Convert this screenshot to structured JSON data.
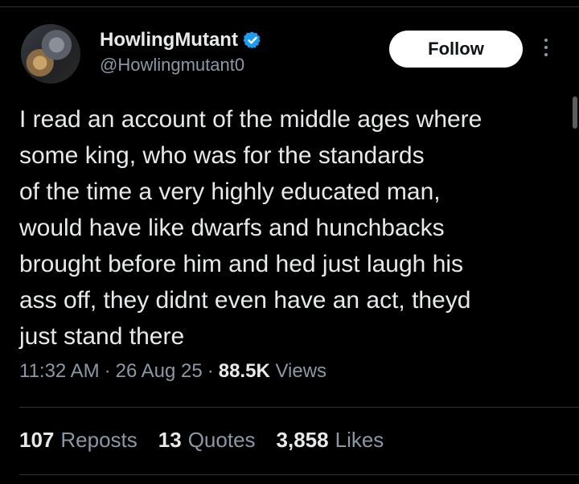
{
  "author": {
    "display_name": "HowlingMutant",
    "handle": "@Howlingmutant0",
    "verified": true
  },
  "actions": {
    "follow_label": "Follow"
  },
  "tweet": {
    "text": "I read an account of the middle ages where\nsome king, who was for the standards\nof the time a very highly educated man,\nwould have like dwarfs and hunchbacks\nbrought before him and hed just laugh his\nass off, they didnt even have an act, theyd\njust stand there",
    "time": "11:32 AM",
    "date": "26 Aug 25",
    "views_count": "88.5K",
    "views_label": "Views"
  },
  "stats": {
    "reposts_count": "107",
    "reposts_label": "Reposts",
    "quotes_count": "13",
    "quotes_label": "Quotes",
    "likes_count": "3,858",
    "likes_label": "Likes"
  },
  "colors": {
    "background": "#000000",
    "text": "#e7e9ea",
    "muted": "#8b98a5",
    "verified": "#1d9bf0"
  }
}
